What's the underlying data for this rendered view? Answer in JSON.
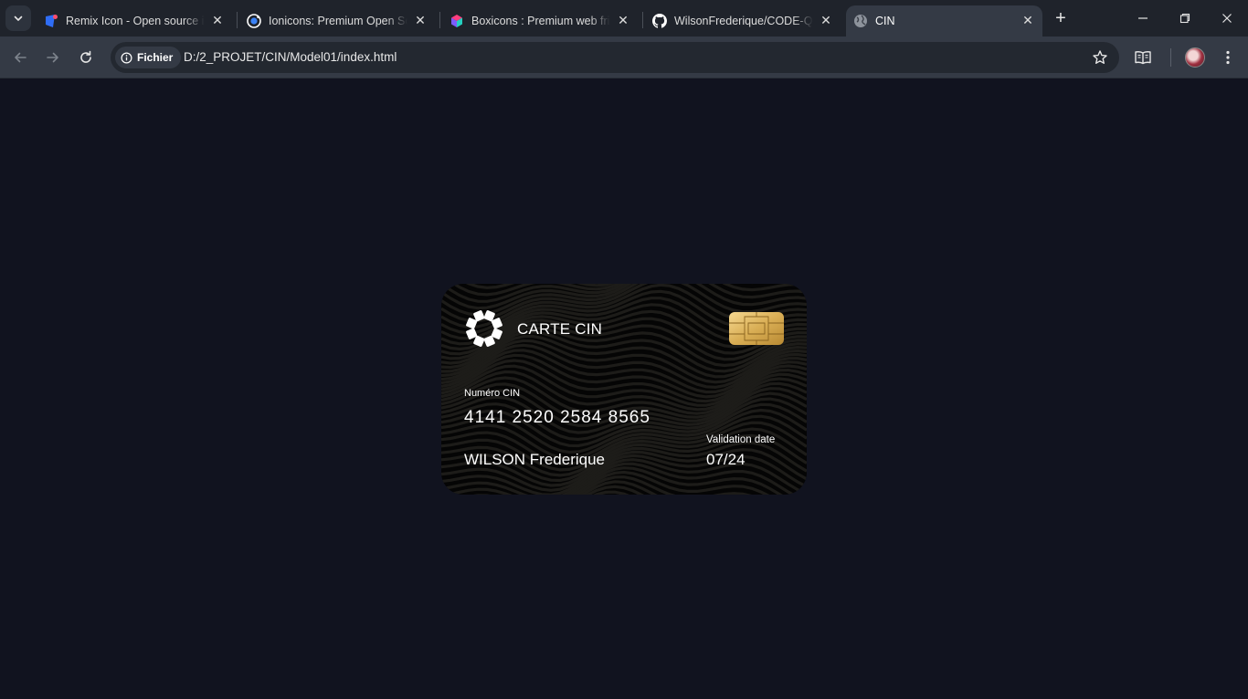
{
  "browser": {
    "tabs": [
      {
        "title": "Remix Icon - Open source icon",
        "favicon": "remixicon-logo-icon",
        "active": false
      },
      {
        "title": "Ionicons: Premium Open Source",
        "favicon": "ionicons-logo-icon",
        "active": false
      },
      {
        "title": "Boxicons : Premium web friendly",
        "favicon": "boxicons-logo-icon",
        "active": false
      },
      {
        "title": "WilsonFrederique/CODE-QR",
        "favicon": "github-icon",
        "active": false
      },
      {
        "title": "CIN",
        "favicon": "globe-icon",
        "active": true
      }
    ],
    "new_tab_icon": "plus-icon",
    "window_controls": [
      "minimize-icon",
      "restore-icon",
      "close-icon"
    ],
    "address": {
      "chip_label": "Fichier",
      "url": "D:/2_PROJET/CIN/Model01/index.html"
    },
    "colors": {
      "tabstrip": "#1f232b",
      "toolbar": "#343a45",
      "omnibox": "#232830"
    }
  },
  "page": {
    "background": "#11131f",
    "card": {
      "title": "CARTE CIN",
      "number_label": "Numéro CIN",
      "number": "4141 2520 2584 8565",
      "holder": "WILSON Frederique",
      "validation_label": "Validation date",
      "validation_date": "07/24",
      "logo_icon": "sun-loader-icon",
      "chip_icon": "sim-chip-icon",
      "chip_color": "#d4a84a"
    }
  }
}
